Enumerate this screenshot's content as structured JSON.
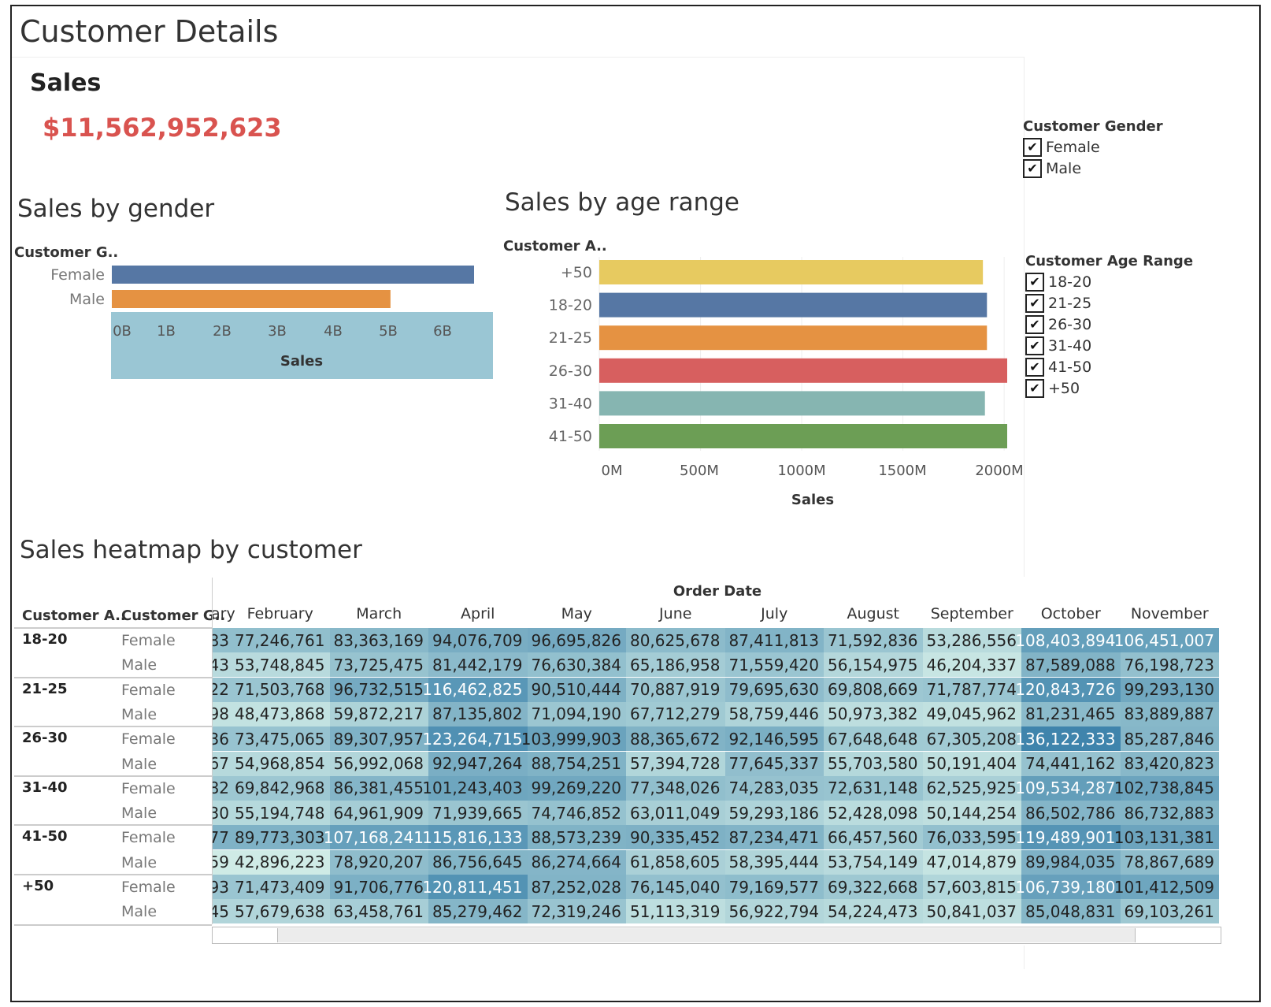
{
  "page": {
    "title": "Customer Details"
  },
  "kpi": {
    "title": "Sales",
    "value": "$11,562,952,623",
    "value_color": "#d9534f"
  },
  "gender_filter": {
    "title": "Customer Gender",
    "options": [
      "Female",
      "Male"
    ]
  },
  "age_filter": {
    "title": "Customer Age Range",
    "options": [
      "18-20",
      "21-25",
      "26-30",
      "31-40",
      "41-50",
      "+50"
    ]
  },
  "gender_chart": {
    "title": "Sales by gender",
    "row_header": "Customer G..",
    "chart_data": {
      "type": "bar",
      "orientation": "horizontal",
      "categories": [
        "Female",
        "Male"
      ],
      "values": [
        6.5,
        5.0
      ],
      "value_unit": "B",
      "xlabel": "Sales",
      "xlim": [
        0,
        6.5
      ],
      "xticks": [
        "0B",
        "1B",
        "2B",
        "3B",
        "4B",
        "5B",
        "6B"
      ],
      "colors": [
        "#5677a4",
        "#e59242"
      ]
    }
  },
  "age_chart": {
    "title": "Sales by age range",
    "row_header": "Customer A..",
    "chart_data": {
      "type": "bar",
      "orientation": "horizontal",
      "categories": [
        "+50",
        "18-20",
        "21-25",
        "26-30",
        "31-40",
        "41-50"
      ],
      "values": [
        1895,
        1915,
        1915,
        2015,
        1905,
        2015
      ],
      "value_unit": "M",
      "xlabel": "Sales",
      "xlim": [
        0,
        2015
      ],
      "xticks": [
        "0M",
        "500M",
        "1000M",
        "1500M",
        "2000M"
      ],
      "colors": [
        "#e7ca60",
        "#5677a4",
        "#e59242",
        "#d75f5f",
        "#86b5b1",
        "#6c9e55"
      ]
    }
  },
  "heatmap": {
    "title": "Sales heatmap by customer",
    "col_group_header": "Order Date",
    "row_headers": [
      "Customer A..",
      "Customer G.."
    ],
    "partial_col_label": "ary",
    "columns": [
      "February",
      "March",
      "April",
      "May",
      "June",
      "July",
      "August",
      "September",
      "October",
      "November"
    ],
    "groups": [
      {
        "age": "18-20",
        "rows": [
          {
            "gender": "Female",
            "partial": "83",
            "values": [
              "77,246,761",
              "83,363,169",
              "94,076,709",
              "96,695,826",
              "80,625,678",
              "87,411,813",
              "71,592,836",
              "53,286,556",
              "108,403,894",
              "106,451,007"
            ]
          },
          {
            "gender": "Male",
            "partial": "43",
            "values": [
              "53,748,845",
              "73,725,475",
              "81,442,179",
              "76,630,384",
              "65,186,958",
              "71,559,420",
              "56,154,975",
              "46,204,337",
              "87,589,088",
              "76,198,723"
            ]
          }
        ]
      },
      {
        "age": "21-25",
        "rows": [
          {
            "gender": "Female",
            "partial": "22",
            "values": [
              "71,503,768",
              "96,732,515",
              "116,462,825",
              "90,510,444",
              "70,887,919",
              "79,695,630",
              "69,808,669",
              "71,787,774",
              "120,843,726",
              "99,293,130"
            ]
          },
          {
            "gender": "Male",
            "partial": "98",
            "values": [
              "48,473,868",
              "59,872,217",
              "87,135,802",
              "71,094,190",
              "67,712,279",
              "58,759,446",
              "50,973,382",
              "49,045,962",
              "81,231,465",
              "83,889,887"
            ]
          }
        ]
      },
      {
        "age": "26-30",
        "rows": [
          {
            "gender": "Female",
            "partial": "36",
            "values": [
              "73,475,065",
              "89,307,957",
              "123,264,715",
              "103,999,903",
              "88,365,672",
              "92,146,595",
              "67,648,648",
              "67,305,208",
              "136,122,333",
              "85,287,846"
            ]
          },
          {
            "gender": "Male",
            "partial": "67",
            "values": [
              "54,968,854",
              "56,992,068",
              "92,947,264",
              "88,754,251",
              "57,394,728",
              "77,645,337",
              "55,703,580",
              "50,191,404",
              "74,441,162",
              "83,420,823"
            ]
          }
        ]
      },
      {
        "age": "31-40",
        "rows": [
          {
            "gender": "Female",
            "partial": "82",
            "values": [
              "69,842,968",
              "86,381,455",
              "101,243,403",
              "99,269,220",
              "77,348,026",
              "74,283,035",
              "72,631,148",
              "62,525,925",
              "109,534,287",
              "102,738,845"
            ]
          },
          {
            "gender": "Male",
            "partial": "30",
            "values": [
              "55,194,748",
              "64,961,909",
              "71,939,665",
              "74,746,852",
              "63,011,049",
              "59,293,186",
              "52,428,098",
              "50,144,254",
              "86,502,786",
              "86,732,883"
            ]
          }
        ]
      },
      {
        "age": "41-50",
        "rows": [
          {
            "gender": "Female",
            "partial": "77",
            "values": [
              "89,773,303",
              "107,168,241",
              "115,816,133",
              "88,573,239",
              "90,335,452",
              "87,234,471",
              "66,457,560",
              "76,033,595",
              "119,489,901",
              "103,131,381"
            ]
          },
          {
            "gender": "Male",
            "partial": "59",
            "values": [
              "42,896,223",
              "78,920,207",
              "86,756,645",
              "86,274,664",
              "61,858,605",
              "58,395,444",
              "53,754,149",
              "47,014,879",
              "89,984,035",
              "78,867,689"
            ]
          }
        ]
      },
      {
        "age": "+50",
        "rows": [
          {
            "gender": "Female",
            "partial": "93",
            "values": [
              "71,473,409",
              "91,706,776",
              "120,811,451",
              "87,252,028",
              "76,145,040",
              "79,169,577",
              "69,322,668",
              "57,603,815",
              "106,739,180",
              "101,412,509"
            ]
          },
          {
            "gender": "Male",
            "partial": "45",
            "values": [
              "57,679,638",
              "63,458,761",
              "85,279,462",
              "72,319,246",
              "51,113,319",
              "56,922,794",
              "54,224,473",
              "50,841,037",
              "85,048,831",
              "69,103,261"
            ]
          }
        ]
      }
    ]
  }
}
